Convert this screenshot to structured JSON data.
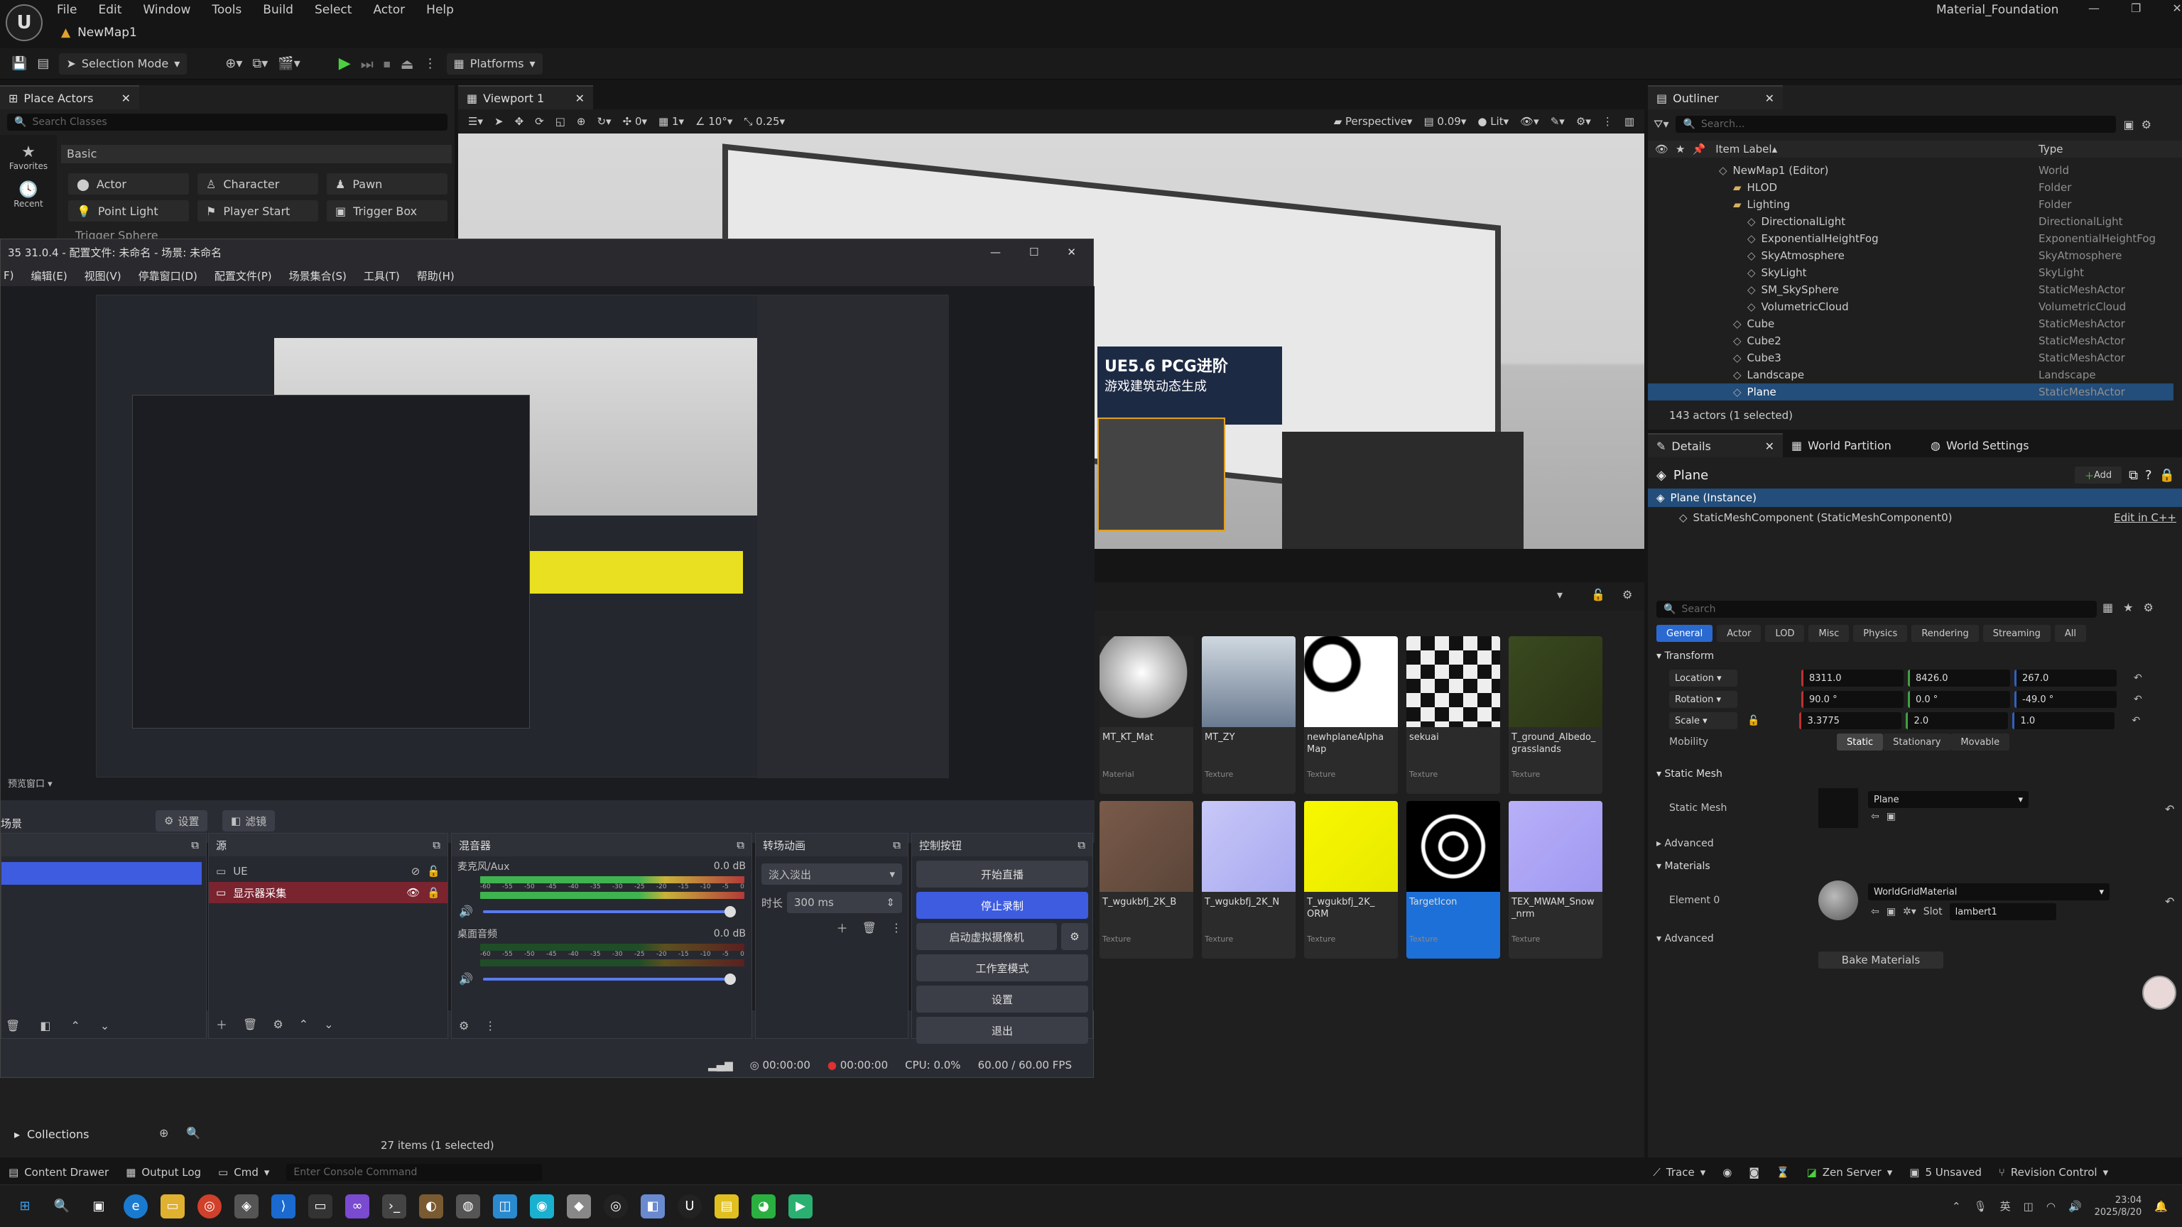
{
  "titlebar": {
    "menu": [
      "File",
      "Edit",
      "Window",
      "Tools",
      "Build",
      "Select",
      "Actor",
      "Help"
    ],
    "project": "Material_Foundation",
    "map_tab": "NewMap1"
  },
  "toolbar": {
    "selection_mode": "Selection Mode",
    "platforms": "Platforms"
  },
  "place_actors": {
    "tab": "Place Actors",
    "search_placeholder": "Search Classes",
    "category": "Basic",
    "side": [
      "Favorites",
      "Recent"
    ],
    "items": [
      "Actor",
      "Character",
      "Pawn",
      "Point Light",
      "Player Start",
      "Trigger Box",
      "Trigger Sphere"
    ]
  },
  "viewport": {
    "tab": "Viewport 1",
    "perspective": "Perspective",
    "lit": "Lit",
    "rot_snap": "10°",
    "scale_snap": "0.25",
    "cam_speed": "0.09",
    "grid_val": "1",
    "angle_val": "0",
    "billboard_text": "UE5.6 PCG进阶",
    "billboard_sub": "游戏建筑动态生成"
  },
  "obs": {
    "title": "35 31.0.4 - 配置文件: 未命名 - 场景: 未命名",
    "menu": [
      "F)",
      "编辑(E)",
      "视图(V)",
      "停靠窗口(D)",
      "配置文件(P)",
      "场景集合(S)",
      "工具(T)",
      "帮助(H)"
    ],
    "preview_label": "预览窗口",
    "scenes_title": "场景",
    "settings_btn": "设置",
    "filters_btn": "滤镜",
    "sources_title": "源",
    "sources": [
      "UE",
      "显示器采集"
    ],
    "mixer_title": "混音器",
    "mixer_mic": "麦克风/Aux",
    "mixer_mic_db": "0.0 dB",
    "mixer_desktop": "桌面音频",
    "mixer_desktop_db": "0.0 dB",
    "meter_ticks": [
      "-60",
      "-55",
      "-50",
      "-45",
      "-40",
      "-35",
      "-30",
      "-25",
      "-20",
      "-15",
      "-10",
      "-5",
      "0"
    ],
    "transitions_title": "转场动画",
    "transition": "淡入淡出",
    "duration_label": "时长",
    "duration": "300 ms",
    "controls_title": "控制按钮",
    "controls": [
      "开始直播",
      "停止录制",
      "启动虚拟摄像机",
      "工作室模式",
      "设置",
      "退出"
    ],
    "status_time1": "00:00:00",
    "status_time2": "00:00:00",
    "status_cpu": "CPU: 0.0%",
    "status_fps": "60.00 / 60.00 FPS"
  },
  "outliner": {
    "tab": "Outliner",
    "search_placeholder": "Search...",
    "col_label": "Item Label",
    "col_type": "Type",
    "rows": [
      {
        "label": "NewMap1 (Editor)",
        "type": "World",
        "indent": 0
      },
      {
        "label": "HLOD",
        "type": "Folder",
        "indent": 1
      },
      {
        "label": "Lighting",
        "type": "Folder",
        "indent": 1
      },
      {
        "label": "DirectionalLight",
        "type": "DirectionalLight",
        "indent": 2
      },
      {
        "label": "ExponentialHeightFog",
        "type": "ExponentialHeightFog",
        "indent": 2
      },
      {
        "label": "SkyAtmosphere",
        "type": "SkyAtmosphere",
        "indent": 2
      },
      {
        "label": "SkyLight",
        "type": "SkyLight",
        "indent": 2
      },
      {
        "label": "SM_SkySphere",
        "type": "StaticMeshActor",
        "indent": 2
      },
      {
        "label": "VolumetricCloud",
        "type": "VolumetricCloud",
        "indent": 2
      },
      {
        "label": "Cube",
        "type": "StaticMeshActor",
        "indent": 1
      },
      {
        "label": "Cube2",
        "type": "StaticMeshActor",
        "indent": 1
      },
      {
        "label": "Cube3",
        "type": "StaticMeshActor",
        "indent": 1
      },
      {
        "label": "Landscape",
        "type": "Landscape",
        "indent": 1
      },
      {
        "label": "Plane",
        "type": "StaticMeshActor",
        "indent": 1
      }
    ],
    "count": "143 actors (1 selected)"
  },
  "details": {
    "tabs": [
      "Details",
      "World Partition",
      "World Settings"
    ],
    "actor": "Plane",
    "add": "Add",
    "instance": "Plane (Instance)",
    "component": "StaticMeshComponent (StaticMeshComponent0)",
    "edit_cpp": "Edit in C++",
    "search_placeholder": "Search",
    "filters": [
      "General",
      "Actor",
      "LOD",
      "Misc",
      "Physics",
      "Rendering",
      "Streaming",
      "All"
    ],
    "transform": "Transform",
    "location": "Location",
    "rotation": "Rotation",
    "scale": "Scale",
    "loc": [
      "8311.0",
      "8426.0",
      "267.0"
    ],
    "rot": [
      "90.0 °",
      "0.0 °",
      "-49.0 °"
    ],
    "scl": [
      "3.3775",
      "2.0",
      "1.0"
    ],
    "mobility": "Mobility",
    "mobility_opts": [
      "Static",
      "Stationary",
      "Movable"
    ],
    "static_mesh_section": "Static Mesh",
    "static_mesh_label": "Static Mesh",
    "static_mesh_value": "Plane",
    "advanced": "Advanced",
    "materials": "Materials",
    "element0": "Element 0",
    "material_value": "WorldGridMaterial",
    "slot_label": "Slot",
    "slot_value": "lambert1",
    "bake": "Bake Materials"
  },
  "content": {
    "tiles": [
      {
        "name": "MT_KT_Mat",
        "type": "Material",
        "sel": false
      },
      {
        "name": "MT_ZY",
        "type": "Texture",
        "sel": false
      },
      {
        "name": "newhplaneAlpha Map",
        "type": "Texture",
        "sel": false
      },
      {
        "name": "sekuai",
        "type": "Texture",
        "sel": false
      },
      {
        "name": "T_ground_Albedo_ grasslands",
        "type": "Texture",
        "sel": false
      },
      {
        "name": "T_wgukbfj_2K_B",
        "type": "Texture",
        "sel": false
      },
      {
        "name": "T_wgukbfj_2K_N",
        "type": "Texture",
        "sel": false
      },
      {
        "name": "T_wgukbfj_2K_ ORM",
        "type": "Texture",
        "sel": false
      },
      {
        "name": "TargetIcon",
        "type": "Texture",
        "sel": true
      },
      {
        "name": "TEX_MWAM_Snow _nrm",
        "type": "Texture",
        "sel": false
      }
    ],
    "collections": "Collections",
    "items_count": "27 items (1 selected)"
  },
  "status": {
    "content_drawer": "Content Drawer",
    "output_log": "Output Log",
    "cmd": "Cmd",
    "console_placeholder": "Enter Console Command",
    "trace": "Trace",
    "zen": "Zen Server",
    "unsaved": "5 Unsaved",
    "revision": "Revision Control"
  },
  "taskbar": {
    "time": "23:04",
    "date": "2025/8/20",
    "ime": "英"
  }
}
